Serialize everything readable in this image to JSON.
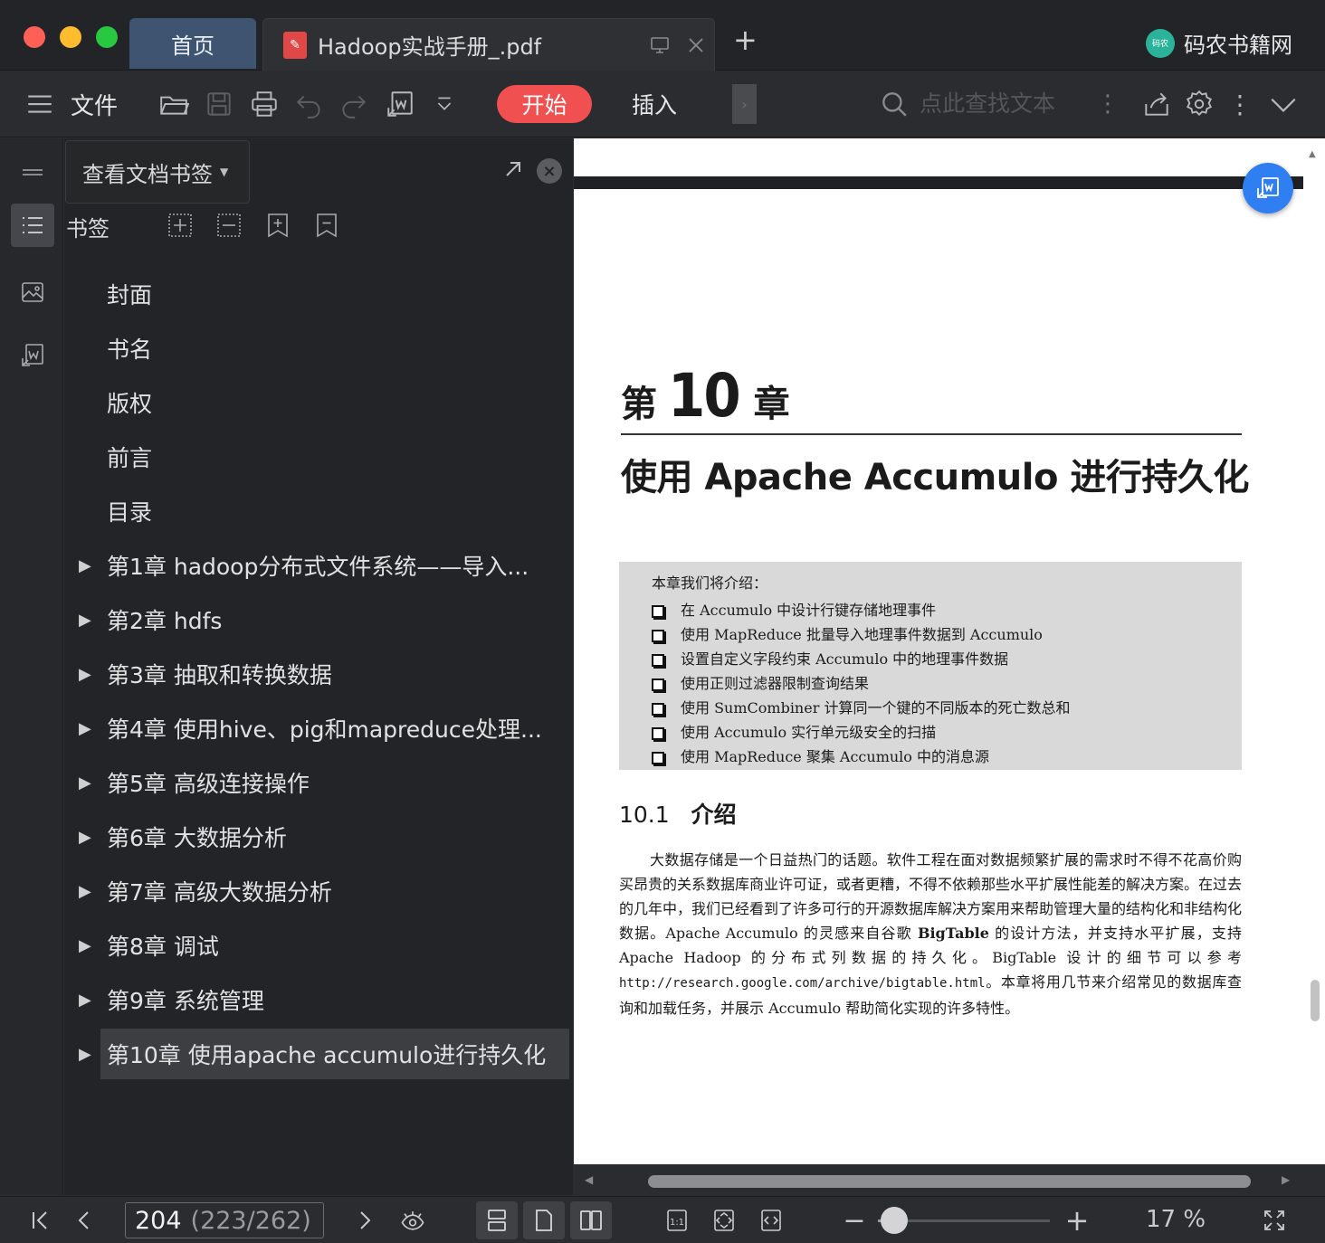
{
  "tabs": {
    "home_label": "首页",
    "doc_title": "Hadoop实战手册_.pdf"
  },
  "brand": {
    "logo_text": "码农",
    "name": "码农书籍网"
  },
  "toolbar": {
    "file_label": "文件",
    "start_label": "开始",
    "insert_label": "插入",
    "search_placeholder": "点此查找文本"
  },
  "panel": {
    "selector_label": "查看文档书签",
    "bookmark_label": "书签",
    "items": [
      {
        "label": "封面",
        "expandable": false,
        "selected": false
      },
      {
        "label": "书名",
        "expandable": false,
        "selected": false
      },
      {
        "label": "版权",
        "expandable": false,
        "selected": false
      },
      {
        "label": "前言",
        "expandable": false,
        "selected": false
      },
      {
        "label": "目录",
        "expandable": false,
        "selected": false
      },
      {
        "label": "第1章 hadoop分布式文件系统——导入...",
        "expandable": true,
        "selected": false
      },
      {
        "label": "第2章 hdfs",
        "expandable": true,
        "selected": false
      },
      {
        "label": "第3章 抽取和转换数据",
        "expandable": true,
        "selected": false
      },
      {
        "label": "第4章 使用hive、pig和mapreduce处理...",
        "expandable": true,
        "selected": false
      },
      {
        "label": "第5章 高级连接操作",
        "expandable": true,
        "selected": false
      },
      {
        "label": "第6章 大数据分析",
        "expandable": true,
        "selected": false
      },
      {
        "label": "第7章 高级大数据分析",
        "expandable": true,
        "selected": false
      },
      {
        "label": "第8章 调试",
        "expandable": true,
        "selected": false
      },
      {
        "label": "第9章 系统管理",
        "expandable": true,
        "selected": false
      },
      {
        "label": "第10章 使用apache accumulo进行持久化",
        "expandable": true,
        "selected": true
      }
    ]
  },
  "page": {
    "chapter_prefix": "第",
    "chapter_number": "10",
    "chapter_suffix": "章",
    "chapter_title": "使用 Apache Accumulo 进行持久化",
    "intro_heading": "本章我们将介绍：",
    "intro_items": [
      "在 Accumulo 中设计行键存储地理事件",
      "使用 MapReduce 批量导入地理事件数据到 Accumulo",
      "设置自定义字段约束 Accumulo 中的地理事件数据",
      "使用正则过滤器限制查询结果",
      "使用 SumCombiner 计算同一个键的不同版本的死亡数总和",
      "使用 Accumulo 实行单元级安全的扫描",
      "使用 MapReduce 聚集 Accumulo 中的消息源"
    ],
    "section_number": "10.1",
    "section_title": "介绍",
    "body_part1": "大数据存储是一个日益热门的话题。软件工程在面对数据频繁扩展的需求时不得不花高价购买昂贵的关系数据库商业许可证，或者更糟，不得不依赖那些水平扩展性能差的解决方案。在过去的几年中，我们已经看到了许多可行的开源数据库解决方案用来帮助管理大量的结构化和非结构化数据。Apache Accumulo 的灵感来自谷歌 ",
    "body_bold": "BigTable",
    "body_part2": " 的设计方法，并支持水平扩展，支持 Apache Hadoop 的分布式列数据的持久化。BigTable 设计的细节可以参考 ",
    "body_url": "http://research.google.com/archive/bigtable.html",
    "body_part3": "。本章将用几节来介绍常见的数据库查询和加载任务，并展示 Accumulo 帮助简化实现的许多特性。"
  },
  "status": {
    "current_page": "204",
    "page_total": "(223/262)",
    "zoom_level": "17 %",
    "zoom_fraction": 0.17
  },
  "colors": {
    "accent_start": "#f0504f",
    "home_tab": "#3e5470",
    "float_button": "#2f7ff3"
  }
}
